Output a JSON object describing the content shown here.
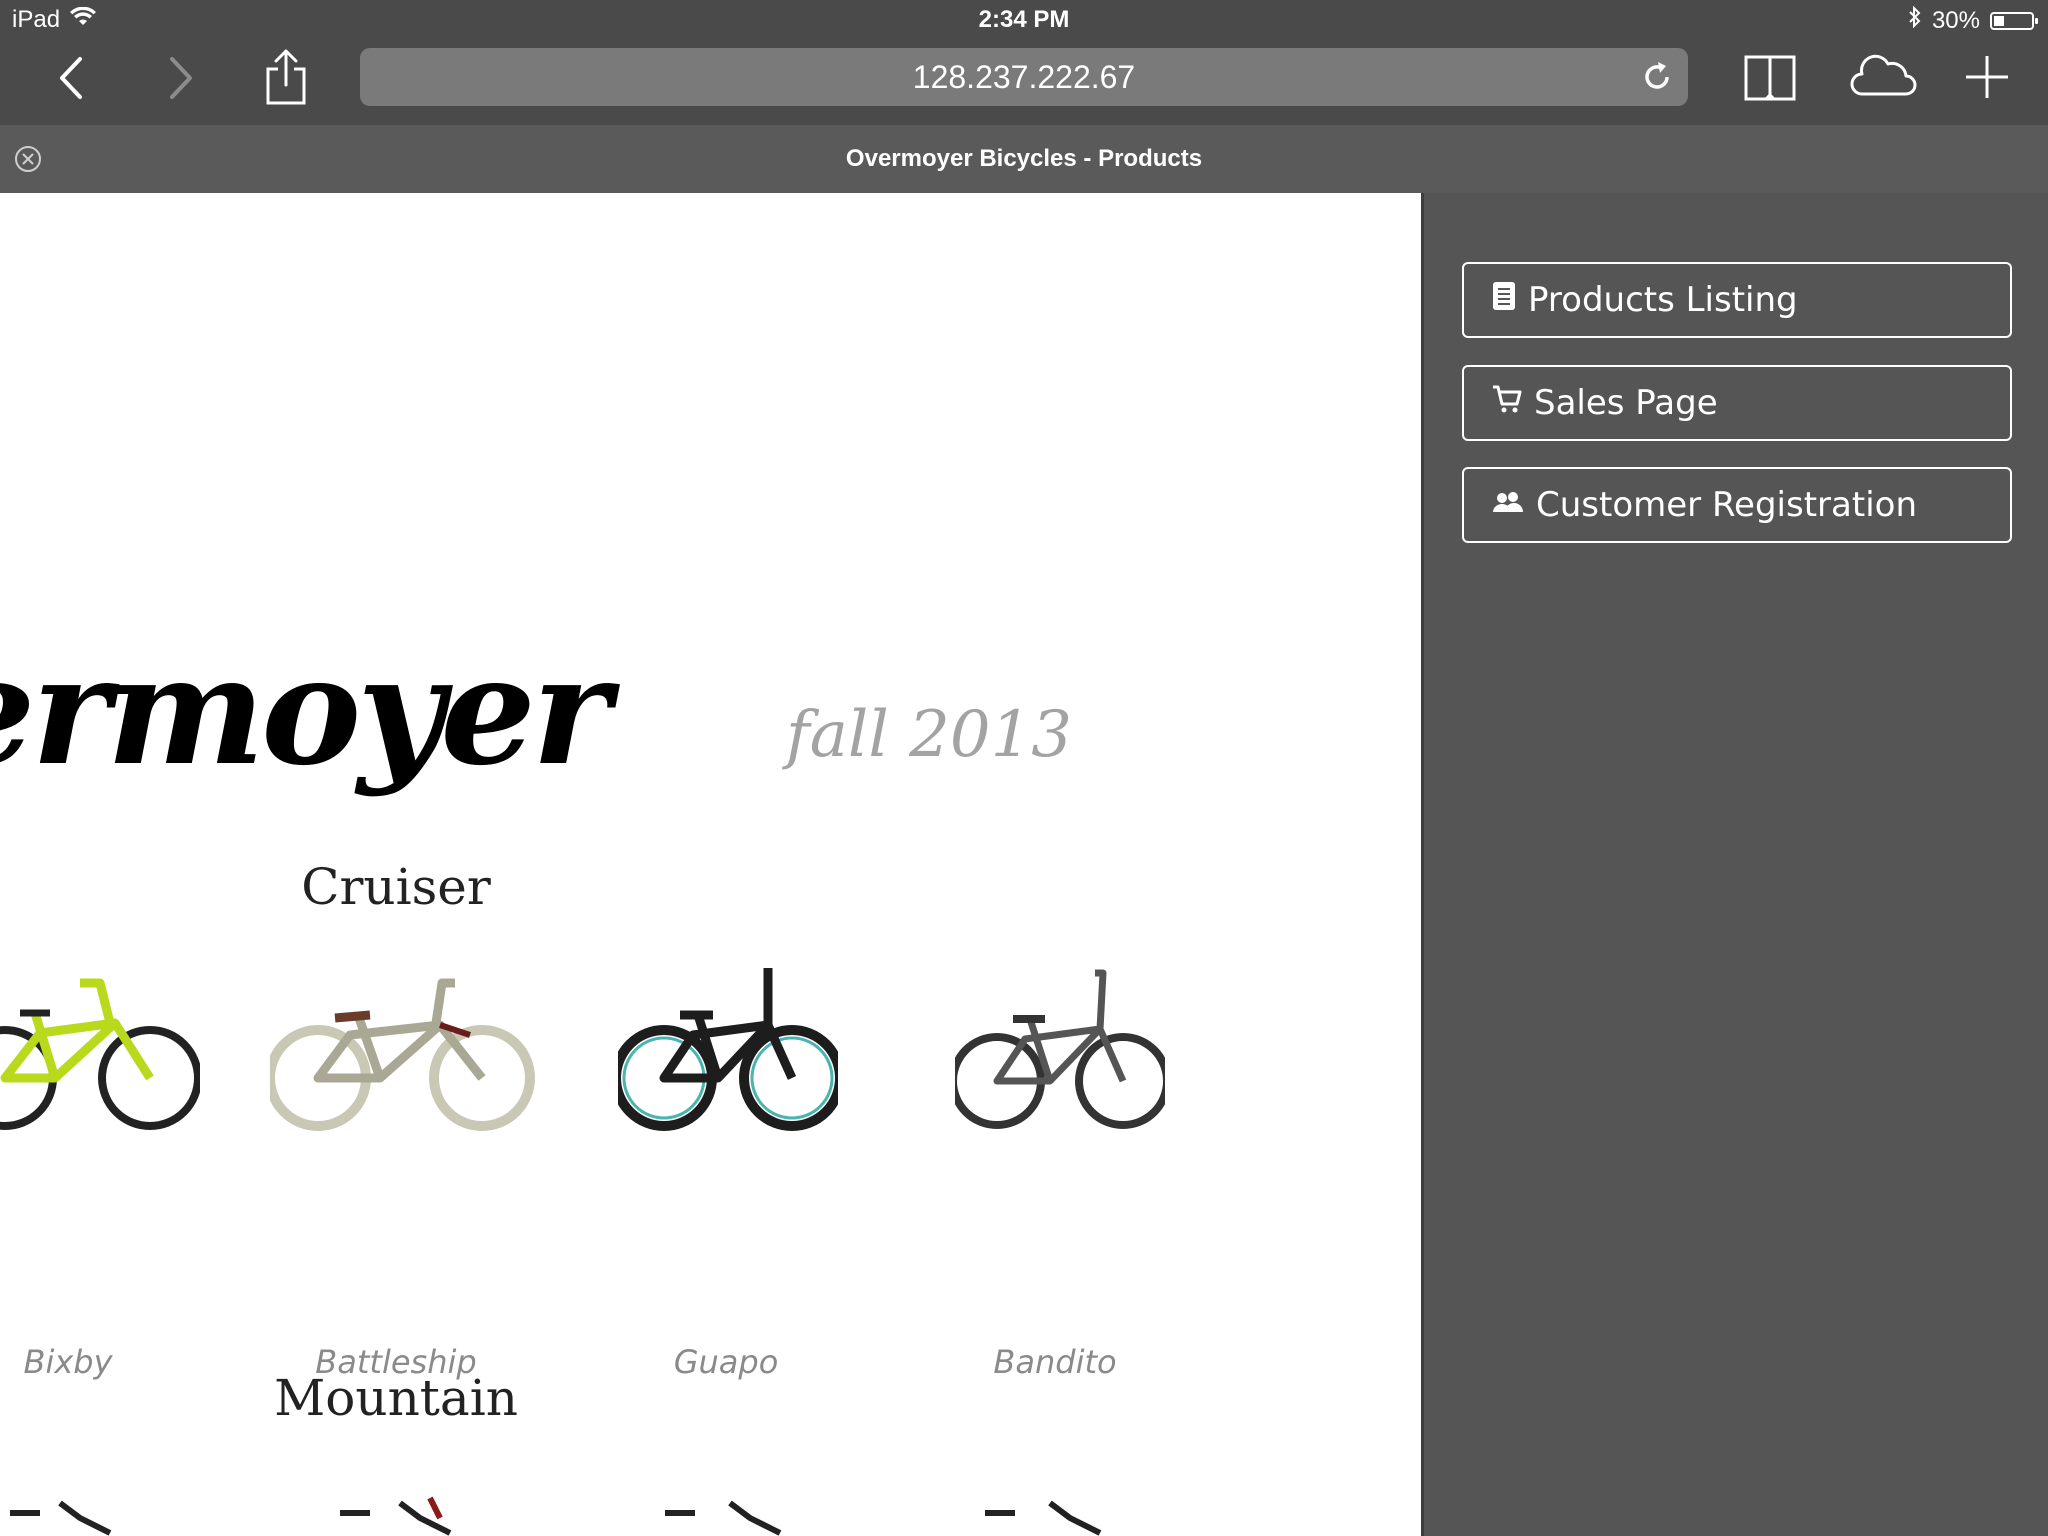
{
  "status_bar": {
    "device": "iPad",
    "time": "2:34 PM",
    "battery": "30%",
    "battery_level": 0.3
  },
  "toolbar": {
    "url": "128.237.222.67"
  },
  "tab": {
    "title": "Overmoyer Bicycles - Products"
  },
  "page": {
    "brand": "ermoyer",
    "season": "fall 2013",
    "categories": [
      {
        "heading": "Cruiser",
        "bikes": [
          {
            "name": "Bixby",
            "color": "#b8d91c"
          },
          {
            "name": "Battleship",
            "color": "#bdbcaa"
          },
          {
            "name": "Guapo",
            "color": "#1d1d1d"
          },
          {
            "name": "Bandito",
            "color": "#4a4a4a"
          }
        ]
      },
      {
        "heading": "Mountain"
      }
    ]
  },
  "sidebar": {
    "items": [
      {
        "label": "Products Listing",
        "icon": "document-icon"
      },
      {
        "label": "Sales Page",
        "icon": "cart-icon"
      },
      {
        "label": "Customer Registration",
        "icon": "users-icon"
      }
    ]
  },
  "colors": {
    "chrome": "#4a4a4a",
    "tabbar": "#5a5a5a",
    "sidebar": "#555555",
    "urlbar": "#7a7a7a"
  }
}
